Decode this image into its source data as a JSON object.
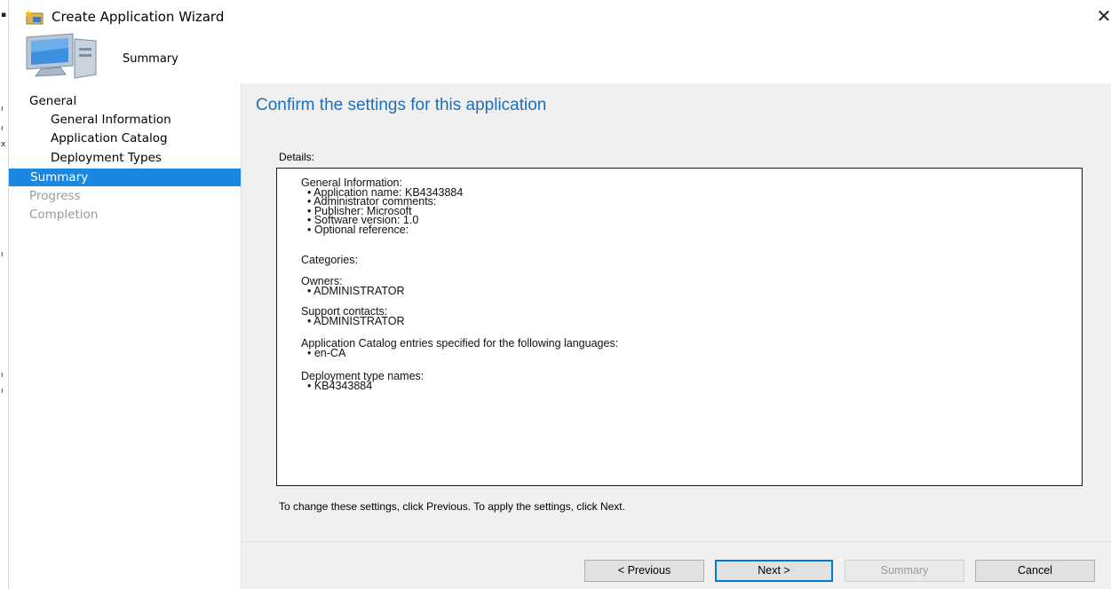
{
  "window": {
    "title": "Create Application Wizard",
    "close_glyph": "✕"
  },
  "banner": {
    "title": "Summary"
  },
  "edge_glyphs": [
    "▪",
    "ı",
    "ı",
    "x",
    "ı",
    "ı",
    "ı"
  ],
  "nav": {
    "items": [
      {
        "label": "General",
        "level": 0,
        "state": "normal"
      },
      {
        "label": "General Information",
        "level": 1,
        "state": "normal"
      },
      {
        "label": "Application Catalog",
        "level": 1,
        "state": "normal"
      },
      {
        "label": "Deployment Types",
        "level": 1,
        "state": "normal"
      },
      {
        "label": "Summary",
        "level": 0,
        "state": "selected"
      },
      {
        "label": "Progress",
        "level": 0,
        "state": "disabled"
      },
      {
        "label": "Completion",
        "level": 0,
        "state": "disabled"
      }
    ]
  },
  "main": {
    "heading": "Confirm the settings for this application",
    "details_label": "Details:",
    "details": {
      "general_info_header": "General Information:",
      "general_info_items": [
        "• Application name: KB4343884",
        "• Administrator comments:",
        "• Publisher: Microsoft",
        "• Software version: 1.0",
        "• Optional reference:"
      ],
      "categories_header": "Categories:",
      "owners_header": "Owners:",
      "owners_items": [
        "• ADMINISTRATOR"
      ],
      "support_header": "Support contacts:",
      "support_items": [
        "• ADMINISTRATOR"
      ],
      "catalog_header": "Application Catalog entries specified for the following languages:",
      "catalog_items": [
        "• en-CA"
      ],
      "deployment_header": "Deployment type names:",
      "deployment_items": [
        "• KB4343884"
      ]
    },
    "hint": "To change these settings, click Previous. To apply the settings, click Next."
  },
  "buttons": {
    "previous": "< Previous",
    "next": "Next >",
    "summary": "Summary",
    "cancel": "Cancel"
  },
  "colors": {
    "accent": "#1c87e0",
    "heading": "#1e6fb8",
    "content_bg": "#f0f0f0",
    "disabled": "#9a9a9a"
  }
}
